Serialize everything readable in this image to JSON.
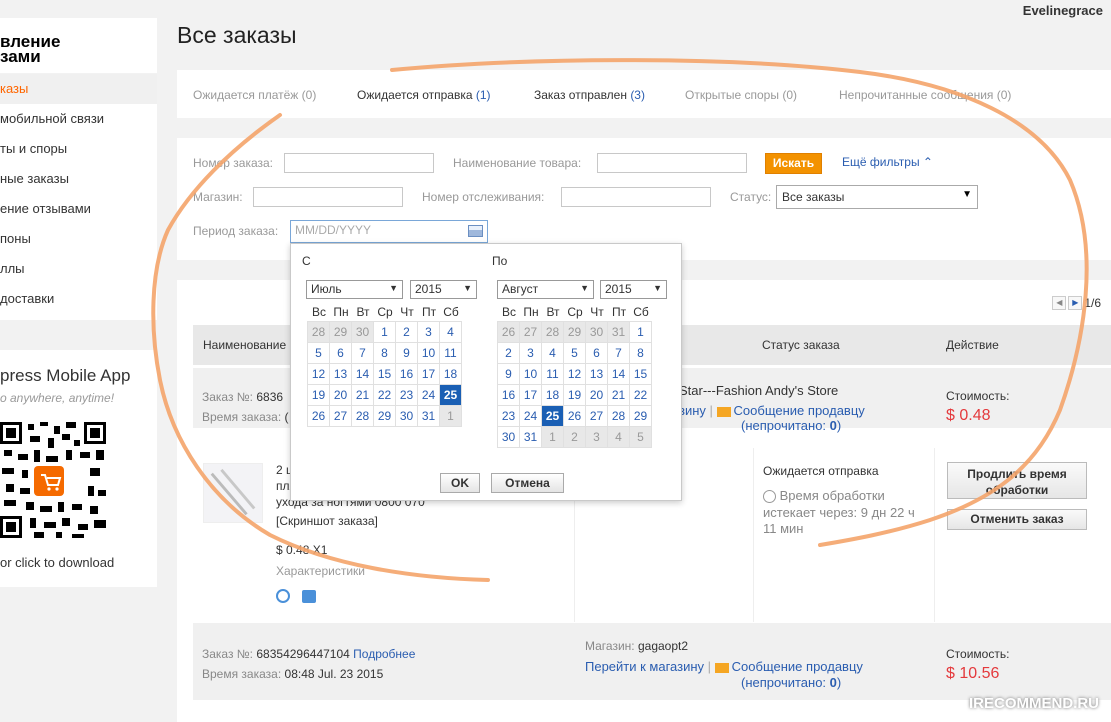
{
  "header": {
    "page_title": "Все заказы",
    "username": "Evelinegrace"
  },
  "sidebar": {
    "title": "вление\nзами",
    "items": [
      {
        "label": "казы",
        "active": true
      },
      {
        "label": " мобильной связи",
        "active": false
      },
      {
        "label": "ты и споры",
        "active": false
      },
      {
        "label": "ные заказы",
        "active": false
      },
      {
        "label": "ение отзывами",
        "active": false
      },
      {
        "label": "поны",
        "active": false
      },
      {
        "label": "ллы",
        "active": false
      },
      {
        "label": " доставки",
        "active": false
      }
    ],
    "app": {
      "title": "press Mobile App",
      "subtitle": "o anywhere, anytime!",
      "download": " or click to download"
    }
  },
  "tabs": [
    {
      "label": "Ожидается платёж",
      "count": "(0)"
    },
    {
      "label": "Ожидается отправка",
      "count": "(1)"
    },
    {
      "label": "Заказ отправлен",
      "count": "(3)"
    },
    {
      "label": "Открытые споры",
      "count": "(0)"
    },
    {
      "label": "Непрочитанные сообщения",
      "count": "(0)"
    }
  ],
  "filters": {
    "order_number_label": "Номер заказа:",
    "product_name_label": "Наименование товара:",
    "search_button": "Искать",
    "more_filters": "Ещё фильтры",
    "store_label": "Магазин:",
    "tracking_label": "Номер отслеживания:",
    "status_label": "Статус:",
    "status_value": "Все заказы",
    "period_label": "Период заказа:",
    "period_placeholder": "MM/DD/YYYY"
  },
  "calendar": {
    "from_label": "С",
    "to_label": "По",
    "left_month": "Июль",
    "left_year": "2015",
    "right_month": "Август",
    "right_year": "2015",
    "weekdays": [
      "Вс",
      "Пн",
      "Вт",
      "Ср",
      "Чт",
      "Пт",
      "Сб"
    ],
    "left_days": [
      {
        "d": "28",
        "o": 1
      },
      {
        "d": "29",
        "o": 1
      },
      {
        "d": "30",
        "o": 1
      },
      {
        "d": "1"
      },
      {
        "d": "2"
      },
      {
        "d": "3"
      },
      {
        "d": "4"
      },
      {
        "d": "5"
      },
      {
        "d": "6"
      },
      {
        "d": "7"
      },
      {
        "d": "8"
      },
      {
        "d": "9"
      },
      {
        "d": "10"
      },
      {
        "d": "11"
      },
      {
        "d": "12"
      },
      {
        "d": "13"
      },
      {
        "d": "14"
      },
      {
        "d": "15"
      },
      {
        "d": "16"
      },
      {
        "d": "17"
      },
      {
        "d": "18"
      },
      {
        "d": "19"
      },
      {
        "d": "20"
      },
      {
        "d": "21"
      },
      {
        "d": "22"
      },
      {
        "d": "23"
      },
      {
        "d": "24"
      },
      {
        "d": "25",
        "s": 1
      },
      {
        "d": "26"
      },
      {
        "d": "27"
      },
      {
        "d": "28"
      },
      {
        "d": "29"
      },
      {
        "d": "30"
      },
      {
        "d": "31"
      },
      {
        "d": "1",
        "o": 1
      }
    ],
    "right_days": [
      {
        "d": "26",
        "o": 1
      },
      {
        "d": "27",
        "o": 1
      },
      {
        "d": "28",
        "o": 1
      },
      {
        "d": "29",
        "o": 1
      },
      {
        "d": "30",
        "o": 1
      },
      {
        "d": "31",
        "o": 1
      },
      {
        "d": "1"
      },
      {
        "d": "2"
      },
      {
        "d": "3"
      },
      {
        "d": "4"
      },
      {
        "d": "5"
      },
      {
        "d": "6"
      },
      {
        "d": "7"
      },
      {
        "d": "8"
      },
      {
        "d": "9"
      },
      {
        "d": "10"
      },
      {
        "d": "11"
      },
      {
        "d": "12"
      },
      {
        "d": "13"
      },
      {
        "d": "14"
      },
      {
        "d": "15"
      },
      {
        "d": "16"
      },
      {
        "d": "17"
      },
      {
        "d": "18"
      },
      {
        "d": "19"
      },
      {
        "d": "20"
      },
      {
        "d": "21"
      },
      {
        "d": "22"
      },
      {
        "d": "23"
      },
      {
        "d": "24"
      },
      {
        "d": "25",
        "s": 1
      },
      {
        "d": "26"
      },
      {
        "d": "27"
      },
      {
        "d": "28"
      },
      {
        "d": "29"
      },
      {
        "d": "30"
      },
      {
        "d": "31"
      },
      {
        "d": "1",
        "o": 1
      },
      {
        "d": "2",
        "o": 1
      },
      {
        "d": "3",
        "o": 1
      },
      {
        "d": "4",
        "o": 1
      },
      {
        "d": "5",
        "o": 1
      }
    ],
    "ok": "OK",
    "cancel": "Отмена"
  },
  "results": {
    "pager": "1/6",
    "columns": [
      "Наименование",
      "Статус заказа",
      "Действие"
    ],
    "orders": [
      {
        "order_label": "Заказ №:",
        "order_no": "6836",
        "time_label": "Время заказа:",
        "time": "(",
        "store": "Star---Fashion Andy's Store",
        "store_link": "зину",
        "message_link": "Сообщение продавцу",
        "unread": "(непрочитано:",
        "unread_count": "0",
        "unread_close": ")",
        "price_label": "Стоимость:",
        "price": "$ 0.48"
      },
      {
        "order_label": "Заказ №:",
        "order_no": "68354296447104",
        "details": "Подробнее",
        "time_label": "Время заказа:",
        "time": "08:48 Jul. 23 2015",
        "store_label": "Магазин:",
        "store": "gagaopt2",
        "store_link": "Перейти к магазину",
        "message_link": "Сообщение продавцу",
        "unread": "(непрочитано:",
        "unread_count": "0",
        "unread_close": ")",
        "price_label": "Стоимость:",
        "price": "$ 10.56"
      }
    ],
    "item": {
      "title_line1": "2 ц",
      "title_line2": "пля",
      "title_line3": "ухода за ногтями 0800 070",
      "screenshot": "[Скриншот заказа]",
      "price": "$ 0.48 X1",
      "specs": "Характеристики",
      "status": "Ожидается отправка",
      "processing": "Время обработки",
      "expires": "истекает через: 9 дн 22 ч",
      "expires2": "11 мин",
      "extend_button": "Продлить время обработки",
      "cancel_button": "Отменить заказ"
    }
  },
  "watermark": "IRECOMMEND.RU",
  "colors": {
    "accent": "#f39200",
    "link": "#2a5db0",
    "price": "#e4393c",
    "scribble": "#f4a46a"
  }
}
